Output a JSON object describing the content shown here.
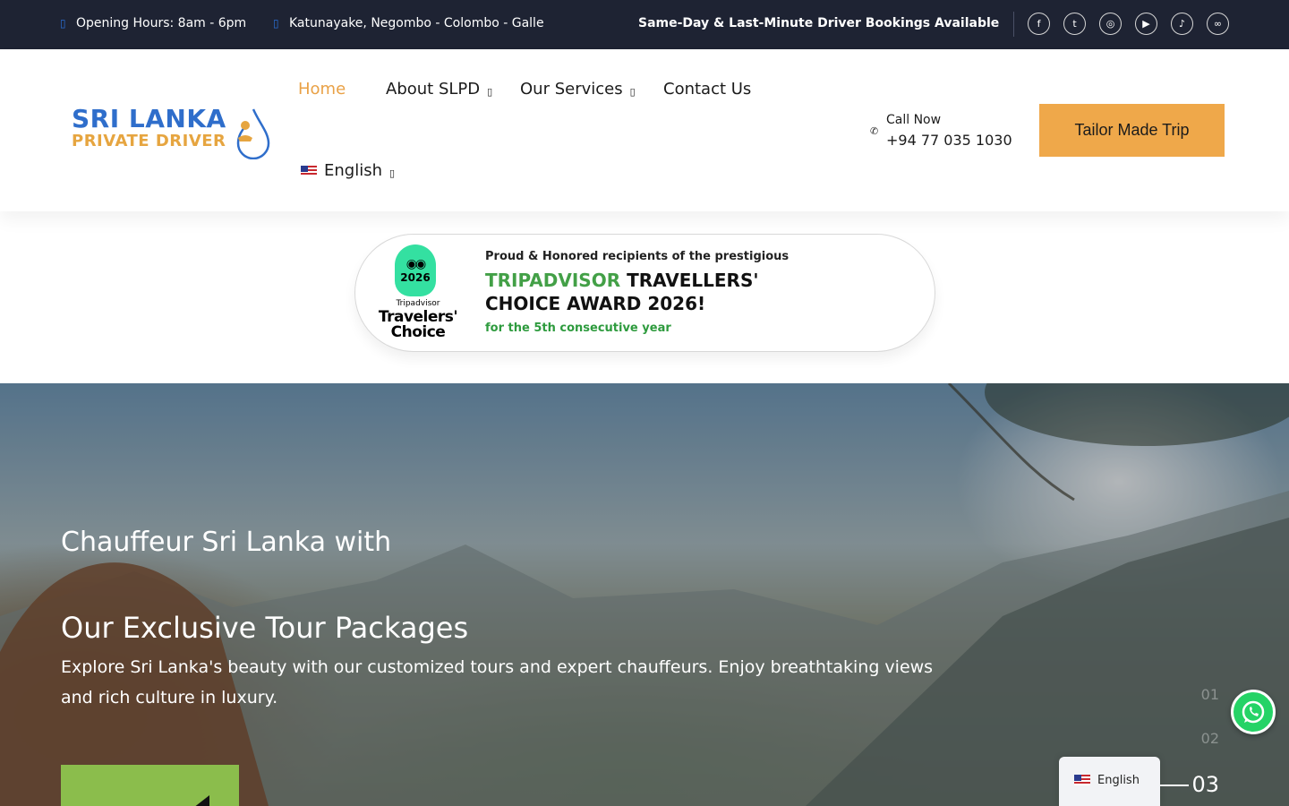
{
  "topbar": {
    "hours": "Opening Hours: 8am - 6pm",
    "locations": "Katunayake, Negombo - Colombo - Galle",
    "tagline": "Same-Day & Last-Minute Driver Bookings Available",
    "social_icons": [
      "facebook-icon",
      "twitter-icon",
      "instagram-icon",
      "youtube-icon",
      "tiktok-icon",
      "tripadvisor-icon"
    ]
  },
  "header": {
    "logo_line1": "SRI LANKA",
    "logo_line2": "PRIVATE DRIVER",
    "nav": [
      {
        "label": "Home",
        "active": true
      },
      {
        "label": "About SLPD",
        "dropdown": true
      },
      {
        "label": "Our Services",
        "dropdown": true
      },
      {
        "label": "Contact Us"
      }
    ],
    "language": "English",
    "call_label": "Call Now",
    "call_number": "+94 77 035 1030",
    "cta": "Tailor Made Trip"
  },
  "award": {
    "badge_year": "2026",
    "badge_brand": "Tripadvisor",
    "badge_title": "Travelers' Choice",
    "kicker": "Proud & Honored recipients of the prestigious",
    "headline_green": "TRIPADVISOR",
    "headline_rest": " TRAVELLERS' CHOICE AWARD 2026!",
    "sub": "for the 5th consecutive year"
  },
  "hero": {
    "title_line1": "Chauffeur Sri Lanka with",
    "title_line2": "Our Exclusive Tour Packages",
    "description": "Explore Sri Lanka's beauty with our customized tours and expert chauffeurs. Enjoy breathtaking views and rich culture in luxury.",
    "pager": [
      "01",
      "02",
      "03"
    ],
    "active_slide": "03"
  },
  "widgets": {
    "language_switcher": "English"
  },
  "colors": {
    "accent": "#efa84a",
    "nav_active": "#e9a146",
    "topbar": "#1e2333",
    "award_green": "#43a047",
    "whatsapp": "#25d366"
  }
}
